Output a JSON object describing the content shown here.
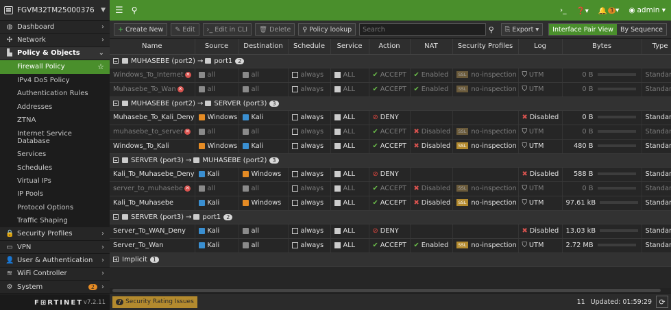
{
  "device": {
    "name": "FGVM32TM25000376"
  },
  "sidebar": {
    "items": [
      {
        "label": "Dashboard",
        "icon": "dashboard-icon",
        "glyph": "◍",
        "arrow": "›"
      },
      {
        "label": "Network",
        "icon": "network-icon",
        "glyph": "✣",
        "arrow": "›"
      },
      {
        "label": "Policy & Objects",
        "icon": "policy-icon",
        "glyph": "▙",
        "arrow": "⌄",
        "open": true
      }
    ],
    "sub_items": [
      {
        "label": "Firewall Policy",
        "active": true
      },
      {
        "label": "IPv4 DoS Policy"
      },
      {
        "label": "Authentication Rules"
      },
      {
        "label": "Addresses"
      },
      {
        "label": "ZTNA"
      },
      {
        "label": "Internet Service Database"
      },
      {
        "label": "Services"
      },
      {
        "label": "Schedules"
      },
      {
        "label": "Virtual IPs"
      },
      {
        "label": "IP Pools"
      },
      {
        "label": "Protocol Options"
      },
      {
        "label": "Traffic Shaping"
      }
    ],
    "bottom_items": [
      {
        "label": "Security Profiles",
        "icon": "lock-icon",
        "glyph": "🔒",
        "arrow": "›"
      },
      {
        "label": "VPN",
        "icon": "vpn-icon",
        "glyph": "▭",
        "arrow": "›"
      },
      {
        "label": "User & Authentication",
        "icon": "user-icon",
        "glyph": "👤",
        "arrow": "›"
      },
      {
        "label": "WiFi Controller",
        "icon": "wifi-icon",
        "glyph": "≋",
        "arrow": "›"
      },
      {
        "label": "System",
        "icon": "gear-icon",
        "glyph": "⚙",
        "arrow": "›",
        "badge": "2"
      }
    ],
    "brand": "F⊞RTINET",
    "version": "v7.2.11"
  },
  "topbar": {
    "cli": "›_",
    "help": "❓▾",
    "bell": "🔔",
    "bell_badge": "3",
    "bell_caret": "▾",
    "user": "admin ▾"
  },
  "toolbar": {
    "create": "Create New",
    "edit": "Edit",
    "edit_cli": "Edit in CLI",
    "delete": "Delete",
    "lookup": "Policy lookup",
    "search_placeholder": "Search",
    "export": "Export ▾",
    "view_pair": "Interface Pair View",
    "view_seq": "By Sequence"
  },
  "columns": [
    "Name",
    "Source",
    "Destination",
    "Schedule",
    "Service",
    "Action",
    "NAT",
    "Security Profiles",
    "Log",
    "Bytes",
    "Type"
  ],
  "groups": [
    {
      "src": "MUHASEBE (port2)",
      "dst": "port1",
      "count": "2",
      "rows": [
        {
          "name": "Windows_To_Internet",
          "disabled": true,
          "src": "all",
          "src_c": "grey",
          "dst": "all",
          "dst_c": "grey",
          "sched": "always",
          "svc": "ALL",
          "action": "ACCEPT",
          "nat": "Enabled",
          "prof": "no-inspection",
          "log": "UTM",
          "bytes": "0 B",
          "type": "Standard"
        },
        {
          "name": "Muhasebe_To_Wan",
          "disabled": true,
          "src": "all",
          "src_c": "grey",
          "dst": "all",
          "dst_c": "grey",
          "sched": "always",
          "svc": "ALL",
          "action": "ACCEPT",
          "nat": "Enabled",
          "prof": "no-inspection",
          "log": "UTM",
          "bytes": "0 B",
          "type": "Standard"
        }
      ]
    },
    {
      "src": "MUHASEBE (port2)",
      "dst": "SERVER (port3)",
      "count": "3",
      "rows": [
        {
          "name": "Muhasebe_To_Kali_Deny",
          "disabled": false,
          "src": "Windows",
          "src_c": "orange",
          "dst": "Kali",
          "dst_c": "blue",
          "sched": "always",
          "svc": "ALL",
          "action": "DENY",
          "nat": "",
          "prof": "",
          "log": "Disabled",
          "bytes": "0 B",
          "type": "Standard"
        },
        {
          "name": "muhasebe_to_server",
          "disabled": true,
          "src": "all",
          "src_c": "grey",
          "dst": "all",
          "dst_c": "grey",
          "sched": "always",
          "svc": "ALL",
          "action": "ACCEPT",
          "nat": "Disabled",
          "prof": "no-inspection",
          "log": "UTM",
          "bytes": "0 B",
          "type": "Standard"
        },
        {
          "name": "Windows_To_Kali",
          "disabled": false,
          "src": "Windows",
          "src_c": "orange",
          "dst": "Kali",
          "dst_c": "blue",
          "sched": "always",
          "svc": "ALL",
          "action": "ACCEPT",
          "nat": "Disabled",
          "prof": "no-inspection",
          "log": "UTM",
          "bytes": "480 B",
          "type": "Standard"
        }
      ]
    },
    {
      "src": "SERVER (port3)",
      "dst": "MUHASEBE (port2)",
      "count": "3",
      "rows": [
        {
          "name": "Kali_To_Muhasebe_Deny",
          "disabled": false,
          "src": "Kali",
          "src_c": "blue",
          "dst": "Windows",
          "dst_c": "orange",
          "sched": "always",
          "svc": "ALL",
          "action": "DENY",
          "nat": "",
          "prof": "",
          "log": "Disabled",
          "bytes": "588 B",
          "type": "Standard"
        },
        {
          "name": "server_to_muhasebe",
          "disabled": true,
          "src": "all",
          "src_c": "grey",
          "dst": "all",
          "dst_c": "grey",
          "sched": "always",
          "svc": "ALL",
          "action": "ACCEPT",
          "nat": "Disabled",
          "prof": "no-inspection",
          "log": "UTM",
          "bytes": "0 B",
          "type": "Standard"
        },
        {
          "name": "Kali_To_Muhasebe",
          "disabled": false,
          "src": "Kali",
          "src_c": "blue",
          "dst": "Windows",
          "dst_c": "orange",
          "sched": "always",
          "svc": "ALL",
          "action": "ACCEPT",
          "nat": "Disabled",
          "prof": "no-inspection",
          "log": "UTM",
          "bytes": "97.61 kB",
          "type": "Standard"
        }
      ]
    },
    {
      "src": "SERVER (port3)",
      "dst": "port1",
      "count": "2",
      "rows": [
        {
          "name": "Server_To_WAN_Deny",
          "disabled": false,
          "src": "Kali",
          "src_c": "blue",
          "dst": "all",
          "dst_c": "grey",
          "sched": "always",
          "svc": "ALL",
          "action": "DENY",
          "nat": "",
          "prof": "",
          "log": "Disabled",
          "bytes": "13.03 kB",
          "type": "Standard"
        },
        {
          "name": "Server_To_Wan",
          "disabled": false,
          "src": "Kali",
          "src_c": "blue",
          "dst": "all",
          "dst_c": "grey",
          "sched": "always",
          "svc": "ALL",
          "action": "ACCEPT",
          "nat": "Enabled",
          "prof": "no-inspection",
          "log": "UTM",
          "bytes": "2.72 MB",
          "type": "Standard"
        }
      ]
    }
  ],
  "implicit": {
    "label": "Implicit",
    "count": "1"
  },
  "bottom": {
    "rating_count": "7",
    "rating_label": "Security Rating Issues",
    "total": "11",
    "updated": "Updated: 01:59:29"
  }
}
